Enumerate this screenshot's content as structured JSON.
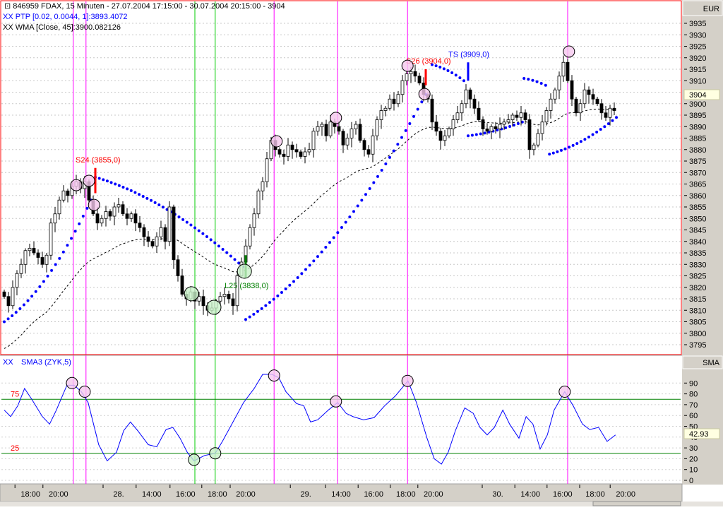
{
  "header": {
    "symbol_line": "846959  FDAX, 15 Minuten - 27.07.2004 17:15:00 - 30.07.2004 20:15:00 - 3904",
    "ptp_line": "XX PTP [0.02, 0.0044, 1]:3893.4072",
    "wma_line": "XX WMA [Close, 45]:3900.082126"
  },
  "colors": {
    "frame": "#ff0000",
    "ptp": "#0000ff",
    "signal_short": "#ff0000",
    "signal_long": "#008000",
    "vline_magenta": "#ff00ff",
    "vline_green": "#00cc00",
    "circle_pink": "#f5c8ee",
    "circle_green": "#c8f0c8",
    "axis_bg": "#d4d0c8",
    "value_box": "#ffffe1"
  },
  "chart_data": [
    {
      "type": "candlestick",
      "title": "846959 FDAX, 15 Minuten",
      "axis_unit": "EUR",
      "ylim": [
        3790,
        3940
      ],
      "yticks": [
        3935,
        3930,
        3925,
        3920,
        3915,
        3910,
        3900,
        3895,
        3890,
        3885,
        3880,
        3875,
        3870,
        3865,
        3860,
        3855,
        3850,
        3845,
        3840,
        3835,
        3830,
        3825,
        3820,
        3815,
        3810,
        3805,
        3800,
        3795
      ],
      "last_value": "3904",
      "xticks": [
        {
          "bar": 6.2,
          "label": "18:00"
        },
        {
          "bar": 12.8,
          "label": "20:00"
        },
        {
          "bar": 27,
          "label": "28."
        },
        {
          "bar": 34.8,
          "label": "14:00"
        },
        {
          "bar": 42.8,
          "label": "16:00"
        },
        {
          "bar": 50.3,
          "label": "18:00"
        },
        {
          "bar": 57,
          "label": "20:00"
        },
        {
          "bar": 71.2,
          "label": "29."
        },
        {
          "bar": 79.5,
          "label": "14:00"
        },
        {
          "bar": 87.2,
          "label": "16:00"
        },
        {
          "bar": 94.8,
          "label": "18:00"
        },
        {
          "bar": 101.3,
          "label": "20:00"
        },
        {
          "bar": 116.5,
          "label": "30."
        },
        {
          "bar": 124.2,
          "label": "14:00"
        },
        {
          "bar": 131.8,
          "label": "16:00"
        },
        {
          "bar": 139.5,
          "label": "18:00"
        },
        {
          "bar": 146.7,
          "label": "20:00"
        }
      ],
      "closes": [
        3816,
        3812,
        3820,
        3826,
        3830,
        3836,
        3837,
        3835,
        3833,
        3830,
        3834,
        3848,
        3852,
        3858,
        3862,
        3860,
        3864,
        3866,
        3863,
        3866,
        3858,
        3852,
        3848,
        3850,
        3853,
        3851,
        3855,
        3856,
        3852,
        3850,
        3852,
        3848,
        3846,
        3842,
        3840,
        3838,
        3842,
        3846,
        3840,
        3855,
        3832,
        3825,
        3817,
        3815,
        3818,
        3814,
        3816,
        3812,
        3810,
        3811,
        3814,
        3816,
        3817,
        3815,
        3812,
        3825,
        3831,
        3838,
        3846,
        3852,
        3862,
        3866,
        3876,
        3884,
        3880,
        3878,
        3877,
        3882,
        3880,
        3879,
        3877,
        3879,
        3880,
        3888,
        3890,
        3891,
        3886,
        3892,
        3890,
        3888,
        3882,
        3885,
        3889,
        3891,
        3884,
        3880,
        3878,
        3886,
        3893,
        3897,
        3898,
        3902,
        3900,
        3904,
        3910,
        3913,
        3914,
        3912,
        3909,
        3904,
        3902,
        3892,
        3888,
        3884,
        3886,
        3889,
        3893,
        3896,
        3900,
        3906,
        3902,
        3898,
        3893,
        3889,
        3888,
        3890,
        3889,
        3891,
        3892,
        3893,
        3895,
        3894,
        3896,
        3893,
        3880,
        3882,
        3887,
        3892,
        3897,
        3902,
        3906,
        3912,
        3918,
        3910,
        3902,
        3896,
        3900,
        3906,
        3904,
        3902,
        3900,
        3896,
        3894,
        3898,
        3897
      ],
      "ptp_segments": [
        {
          "from": [
            0,
            3805
          ],
          "to": [
            20.5,
            3858
          ],
          "dir": "long"
        },
        {
          "from": [
            21.5,
            3868
          ],
          "to": [
            56.3,
            3829
          ],
          "dir": "short"
        },
        {
          "from": [
            57,
            3806
          ],
          "to": [
            99.5,
            3904
          ],
          "dir": "long"
        },
        {
          "from": [
            101,
            3917
          ],
          "to": [
            108.5,
            3910
          ],
          "dir": "short"
        },
        {
          "from": [
            109.5,
            3886
          ],
          "to": [
            122.3,
            3892
          ],
          "dir": "long"
        },
        {
          "from": [
            122.7,
            3911
          ],
          "to": [
            127.8,
            3908
          ],
          "dir": "short"
        },
        {
          "from": [
            128.7,
            3878
          ],
          "to": [
            144.5,
            3894
          ],
          "dir": "long"
        }
      ],
      "signals": [
        {
          "bar": 21.5,
          "high": 3872,
          "low": 3861,
          "type": "short",
          "label": "S24 (3855,0)"
        },
        {
          "bar": 57,
          "high": 3834,
          "low": 3824,
          "type": "long",
          "label": "L25 (3838,0)"
        },
        {
          "bar": 99.5,
          "high": 3915,
          "low": 3908,
          "type": "short",
          "label": "S26 (3904,0)"
        },
        {
          "bar": 109.5,
          "high": 3918,
          "low": 3910,
          "type": "stop",
          "label": "TS (3909,0)"
        }
      ],
      "circles": [
        {
          "bar": 17,
          "price": 3864.5,
          "kind": "top"
        },
        {
          "bar": 20,
          "price": 3866.4,
          "kind": "top"
        },
        {
          "bar": 21.2,
          "price": 3855.9,
          "kind": "top"
        },
        {
          "bar": 64.3,
          "price": 3883.6,
          "kind": "top"
        },
        {
          "bar": 78.3,
          "price": 3893.8,
          "kind": "top"
        },
        {
          "bar": 95.2,
          "price": 3916.5,
          "kind": "top"
        },
        {
          "bar": 99.2,
          "price": 3904.2,
          "kind": "top"
        },
        {
          "bar": 133.3,
          "price": 3922.7,
          "kind": "top"
        },
        {
          "bar": 44.2,
          "price": 3817.2,
          "kind": "bottom"
        },
        {
          "bar": 49.5,
          "price": 3811.3,
          "kind": "bottom"
        },
        {
          "bar": 56.7,
          "price": 3827,
          "kind": "bottom"
        }
      ],
      "vlines": [
        {
          "bar": 16.3,
          "kind": "magenta"
        },
        {
          "bar": 19.3,
          "kind": "magenta"
        },
        {
          "bar": 45,
          "kind": "green"
        },
        {
          "bar": 49.8,
          "kind": "green"
        },
        {
          "bar": 63.7,
          "kind": "magenta"
        },
        {
          "bar": 78.7,
          "kind": "magenta"
        },
        {
          "bar": 95.2,
          "kind": "magenta"
        },
        {
          "bar": 133,
          "kind": "magenta"
        }
      ]
    },
    {
      "type": "line",
      "title": "SMA3 (ZYK,5)",
      "prefix": "XX",
      "axis_unit": "SMA",
      "ylim": [
        0,
        100
      ],
      "yticks": [
        90,
        80,
        70,
        60,
        50,
        40,
        30,
        20,
        10,
        0
      ],
      "levels": [
        {
          "value": 75,
          "label": "75"
        },
        {
          "value": 25,
          "label": "25"
        }
      ],
      "last_value": "42.93",
      "points": [
        [
          0,
          65
        ],
        [
          1.5,
          59
        ],
        [
          3.2,
          69
        ],
        [
          4.8,
          85
        ],
        [
          6.5,
          75
        ],
        [
          9,
          59
        ],
        [
          10.7,
          52
        ],
        [
          12.3,
          65
        ],
        [
          14.8,
          88
        ],
        [
          16.5,
          88
        ],
        [
          18.2,
          82
        ],
        [
          19.8,
          72
        ],
        [
          22.3,
          33
        ],
        [
          24.3,
          18
        ],
        [
          26.5,
          26
        ],
        [
          28.2,
          46
        ],
        [
          29.8,
          54
        ],
        [
          31.5,
          46
        ],
        [
          34,
          33
        ],
        [
          36,
          31
        ],
        [
          38.2,
          47
        ],
        [
          39.8,
          49
        ],
        [
          41.5,
          39
        ],
        [
          43.2,
          26
        ],
        [
          44.8,
          18
        ],
        [
          47.3,
          23
        ],
        [
          49.8,
          25
        ],
        [
          51.5,
          36
        ],
        [
          54,
          54
        ],
        [
          56.5,
          72
        ],
        [
          59,
          85
        ],
        [
          61,
          98
        ],
        [
          63.2,
          98
        ],
        [
          64.8,
          95
        ],
        [
          66.5,
          82
        ],
        [
          69,
          71
        ],
        [
          70.7,
          69
        ],
        [
          72.3,
          54
        ],
        [
          74,
          56
        ],
        [
          76.5,
          65
        ],
        [
          78.7,
          72
        ],
        [
          80.7,
          62
        ],
        [
          82.3,
          59
        ],
        [
          84.8,
          56
        ],
        [
          87.3,
          58
        ],
        [
          89.8,
          69
        ],
        [
          92.3,
          78
        ],
        [
          95.3,
          92
        ],
        [
          97.3,
          72
        ],
        [
          99.8,
          39
        ],
        [
          101.5,
          20
        ],
        [
          103.2,
          15
        ],
        [
          104.8,
          26
        ],
        [
          106.5,
          46
        ],
        [
          108.7,
          67
        ],
        [
          110.7,
          62
        ],
        [
          112.3,
          49
        ],
        [
          114,
          42
        ],
        [
          115.7,
          49
        ],
        [
          117.7,
          65
        ],
        [
          119.3,
          52
        ],
        [
          121.5,
          39
        ],
        [
          123.2,
          59
        ],
        [
          124.8,
          52
        ],
        [
          126.5,
          29
        ],
        [
          128.2,
          42
        ],
        [
          129.8,
          65
        ],
        [
          132.3,
          82
        ],
        [
          134.3,
          69
        ],
        [
          136.5,
          52
        ],
        [
          138.2,
          47
        ],
        [
          140.3,
          49
        ],
        [
          142.3,
          36
        ],
        [
          144.3,
          42
        ]
      ],
      "circles": [
        [
          16,
          90
        ],
        [
          19,
          82
        ],
        [
          44.8,
          19
        ],
        [
          49.8,
          25
        ],
        [
          63.7,
          97
        ],
        [
          78.3,
          73
        ],
        [
          95.2,
          92
        ],
        [
          132.3,
          82
        ]
      ]
    }
  ]
}
